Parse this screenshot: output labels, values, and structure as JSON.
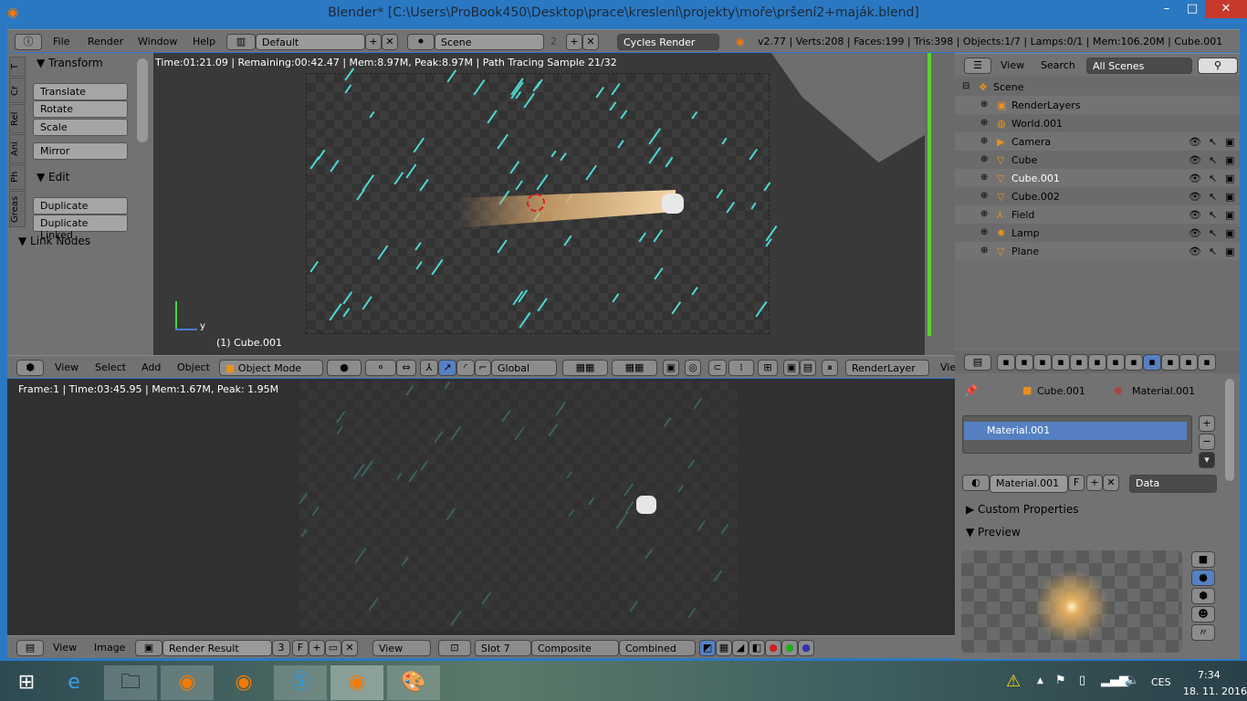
{
  "window": {
    "title": "Blender* [C:\\Users\\ProBook450\\Desktop\\prace\\kreslení\\projekty\\moře\\pršení2+maják.blend]",
    "minimize": "–",
    "maximize": "□",
    "close": "✕"
  },
  "info_header": {
    "menus": [
      "File",
      "Render",
      "Window",
      "Help"
    ],
    "screen_layout": "Default",
    "scene": "Scene",
    "scene_users": "2",
    "render_engine": "Cycles Render",
    "stats": "v2.77 | Verts:208 | Faces:199 | Tris:398 | Objects:1/7 | Lamps:0/1 | Mem:106.20M | Cube.001"
  },
  "tool_shelf": {
    "tabs": [
      "T",
      "Cr",
      "Rel",
      "Ani",
      "Ph",
      "Greas"
    ],
    "transform_title": "Transform",
    "transform_buttons": [
      "Translate",
      "Rotate",
      "Scale"
    ],
    "mirror": "Mirror",
    "edit_title": "Edit",
    "edit_buttons": [
      "Duplicate",
      "Duplicate Linked"
    ],
    "link_nodes_title": "Link Nodes"
  },
  "viewport": {
    "status": "Time:01:21.09 | Remaining:00:42.47 | Mem:8.97M, Peak:8.97M | Path Tracing Sample 21/32",
    "object_label": "(1) Cube.001",
    "axis_y": "y"
  },
  "viewport_header": {
    "menus": [
      "View",
      "Select",
      "Add",
      "Object"
    ],
    "mode": "Object Mode",
    "orientation": "Global",
    "render_layer": "RenderLayer",
    "extra": "Vie"
  },
  "outliner": {
    "menus": [
      "View",
      "Search"
    ],
    "filter": "All Scenes",
    "items": [
      {
        "name": "Scene",
        "icon": "scene-icon",
        "depth": 0,
        "vis": false
      },
      {
        "name": "RenderLayers",
        "icon": "renderlayers-icon",
        "depth": 1,
        "vis": false
      },
      {
        "name": "World.001",
        "icon": "world-icon",
        "depth": 1,
        "vis": false
      },
      {
        "name": "Camera",
        "icon": "camera-icon",
        "depth": 1,
        "vis": true
      },
      {
        "name": "Cube",
        "icon": "mesh-icon",
        "depth": 1,
        "vis": true
      },
      {
        "name": "Cube.001",
        "icon": "mesh-icon",
        "depth": 1,
        "vis": true,
        "selected": true
      },
      {
        "name": "Cube.002",
        "icon": "mesh-icon",
        "depth": 1,
        "vis": true
      },
      {
        "name": "Field",
        "icon": "field-icon",
        "depth": 1,
        "vis": true
      },
      {
        "name": "Lamp",
        "icon": "lamp-icon",
        "depth": 1,
        "vis": true
      },
      {
        "name": "Plane",
        "icon": "mesh-icon",
        "depth": 1,
        "vis": true
      }
    ]
  },
  "properties": {
    "breadcrumb": [
      "Cube.001",
      "Material.001"
    ],
    "slots": [
      "Material.001"
    ],
    "material_name": "Material.001",
    "fake_user": "F",
    "link": "Data",
    "custom_properties": "Custom Properties",
    "preview": "Preview"
  },
  "image_editor": {
    "status": "Frame:1 | Time:03:45.95 | Mem:1.67M, Peak: 1.95M",
    "menus": [
      "View",
      "Image"
    ],
    "image": "Render Result",
    "image_users": "3",
    "fake_user": "F",
    "view": "View",
    "slot": "Slot 7",
    "layer": "Composite",
    "pass": "Combined"
  },
  "taskbar": {
    "apps": [
      "internet-explorer",
      "file-explorer",
      "firefox",
      "blender",
      "skype",
      "blender",
      "paint"
    ],
    "language": "CES",
    "time": "7:34",
    "date": "18. 11. 2016"
  },
  "colors": {
    "titlebar": "#2b78c2",
    "selection": "#5680c2",
    "header": "#727272",
    "viewport": "#393939"
  }
}
